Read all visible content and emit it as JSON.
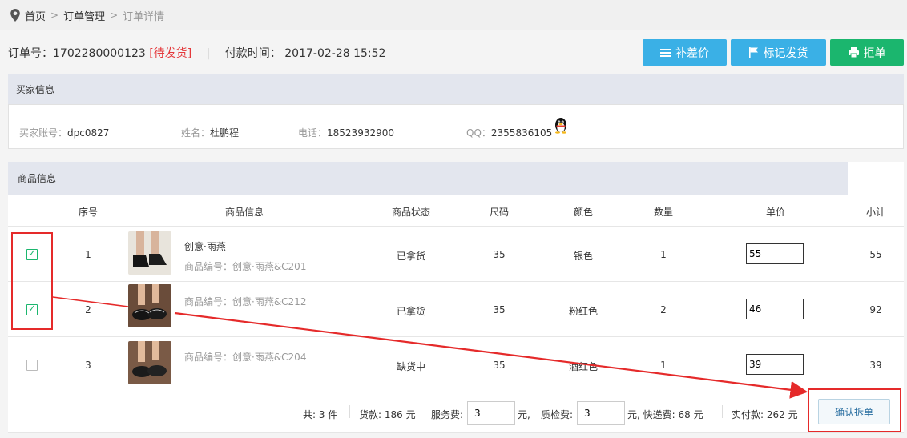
{
  "breadcrumb": {
    "home": "首页",
    "orders": "订单管理",
    "current": "订单详情",
    "separator": ">"
  },
  "order": {
    "no_label": "订单号：",
    "no_value": "1702280000123",
    "status": "[待发货]",
    "pay_label": "付款时间：",
    "pay_value": "2017-02-28 15:52"
  },
  "actions": {
    "supplement": "补差价",
    "mark_shipped": "标记发货",
    "reject": "拒单"
  },
  "buyer": {
    "title": "买家信息",
    "account_label": "买家账号：",
    "account_value": "dpc0827",
    "name_label": "姓名：",
    "name_value": "杜鹏程",
    "phone_label": "电话：",
    "phone_value": "18523932900",
    "qq_label": "QQ：",
    "qq_value": "2355836105"
  },
  "goods": {
    "title": "商品信息",
    "columns": [
      "序号",
      "商品信息",
      "商品状态",
      "尺码",
      "颜色",
      "数量",
      "单价",
      "小计"
    ],
    "rows": [
      {
        "checked": true,
        "index": "1",
        "name": "创意·雨燕",
        "code": "商品编号：创意·雨燕&C201",
        "status": "已拿货",
        "size": "35",
        "color": "银色",
        "qty": "1",
        "price": "55",
        "subtotal": "55"
      },
      {
        "checked": true,
        "index": "2",
        "name": "",
        "code": "商品编号：创意·雨燕&C212",
        "status": "已拿货",
        "size": "35",
        "color": "粉红色",
        "qty": "2",
        "price": "46",
        "subtotal": "92"
      },
      {
        "checked": false,
        "index": "3",
        "name": "",
        "code": "商品编号：创意·雨燕&C204",
        "status": "缺货中",
        "size": "35",
        "color": "酒红色",
        "qty": "1",
        "price": "39",
        "subtotal": "39"
      }
    ]
  },
  "summary": {
    "total_count": "共: 3 件",
    "goods_fee": "货款: 186 元",
    "service_label": "服务费:",
    "service_value": "3",
    "yuan": "元,",
    "qc_label": "质检费:",
    "qc_value": "3",
    "express": "元, 快递费: 68 元",
    "paid": "实付款: 262 元",
    "confirm": "确认拆单"
  },
  "colors": {
    "accent_blue": "#3ab0e6",
    "accent_green": "#1bb66e",
    "status_red": "#e4393c",
    "highlight_red": "#e52a2a"
  }
}
